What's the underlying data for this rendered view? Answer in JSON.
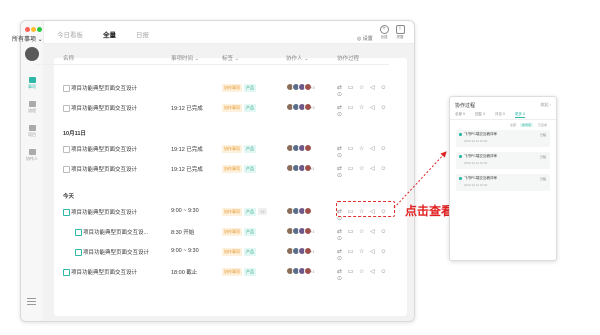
{
  "colors": {
    "accent": "#2db8a8",
    "callout": "#e02020",
    "traffic": [
      "#ff5f57",
      "#febc2e",
      "#28c840"
    ]
  },
  "sidebar": {
    "items": [
      {
        "label": "事项",
        "icon": "task-icon",
        "active": true
      },
      {
        "label": "流程",
        "icon": "flow-icon",
        "active": false
      },
      {
        "label": "项目",
        "icon": "folder-icon",
        "active": false
      },
      {
        "label": "协作人",
        "icon": "people-icon",
        "active": false
      }
    ]
  },
  "header": {
    "tabs": [
      {
        "label": "今日看板",
        "active": false
      },
      {
        "label": "全量",
        "active": true
      },
      {
        "label": "日报",
        "active": false
      }
    ],
    "create_label": "创建",
    "notify_label": "提醒"
  },
  "toolbar": {
    "filter": "所有事项 ⌄",
    "settings": "◎ 设置"
  },
  "table": {
    "headers": [
      "名称",
      "事项时间 ⌄",
      "标签 ⌄",
      "协作人 ⌄",
      "协作过程"
    ],
    "top_rows": [
      {
        "name": "项目功能典型页面交互设计",
        "time": "",
        "tags": [
          {
            "text": "协作事项",
            "style": "o"
          },
          {
            "text": "产品",
            "style": "g"
          }
        ],
        "extra": "+3"
      },
      {
        "name": "项目功能典型页面交互设计",
        "time": "19:12 已完成",
        "tags": [
          {
            "text": "协作事项",
            "style": "o"
          },
          {
            "text": "产品",
            "style": "g"
          }
        ],
        "extra": "+3"
      }
    ],
    "groups": [
      {
        "label": "10月11日",
        "rows": [
          {
            "name": "项目功能典型页面交互设计",
            "time": "19:12 已完成",
            "tags": [
              {
                "text": "协作事项",
                "style": "o"
              },
              {
                "text": "产品",
                "style": "g"
              }
            ],
            "extra": ""
          },
          {
            "name": "项目功能典型页面交互设计",
            "time": "19:12 已完成",
            "tags": [
              {
                "text": "协作事项",
                "style": "o"
              },
              {
                "text": "产品",
                "style": "g"
              }
            ],
            "extra": "+1"
          }
        ]
      },
      {
        "label": "今天",
        "rows": [
          {
            "name": "项目功能典型页面交互设计",
            "time": "9:00 ~ 9:30",
            "tags": [
              {
                "text": "协作事项",
                "style": "o"
              },
              {
                "text": "产品",
                "style": "g"
              },
              {
                "text": "+2",
                "style": "gr"
              }
            ],
            "extra": ""
          },
          {
            "name": "项目功能典型页面交互设...",
            "time": "8:30 开始",
            "tags": [
              {
                "text": "协作事项",
                "style": "o"
              },
              {
                "text": "产品",
                "style": "g"
              }
            ],
            "extra": "+1"
          },
          {
            "name": "项目功能典型页面交互设计",
            "time": "9:00 ~ 9:30",
            "tags": [
              {
                "text": "协作事项",
                "style": "o"
              },
              {
                "text": "产品",
                "style": "g"
              }
            ],
            "extra": "+1"
          },
          {
            "name": "项目功能典型页面交互设计",
            "time": "18:00 截止",
            "tags": [
              {
                "text": "协作事项",
                "style": "o"
              },
              {
                "text": "产品",
                "style": "g"
              }
            ],
            "extra": "+1"
          }
        ]
      }
    ]
  },
  "callout": {
    "text": "点击查看详细协作过程"
  },
  "popup": {
    "title": "协作过程",
    "close": "收起 ›",
    "tabs": [
      {
        "label": "全部 9",
        "active": false
      },
      {
        "label": "回复 3",
        "active": false
      },
      {
        "label": "评论 0",
        "active": false
      },
      {
        "label": "更多 5",
        "active": true
      }
    ],
    "filters": [
      {
        "label": "全部",
        "selected": false
      },
      {
        "label": "新增项",
        "selected": true
      },
      {
        "label": "已完成",
        "selected": false
      }
    ],
    "cards": [
      {
        "title": "飞书PC端交互稿评审",
        "sub": "2020.10.12 10:00",
        "right": "日程"
      },
      {
        "title": "飞书PC端交互稿评审",
        "sub": "2020.10.12 10:00",
        "right": "日程"
      },
      {
        "title": "飞书PC端交互稿评审",
        "sub": "2020.10.12 10:00",
        "right": "日程"
      }
    ]
  }
}
